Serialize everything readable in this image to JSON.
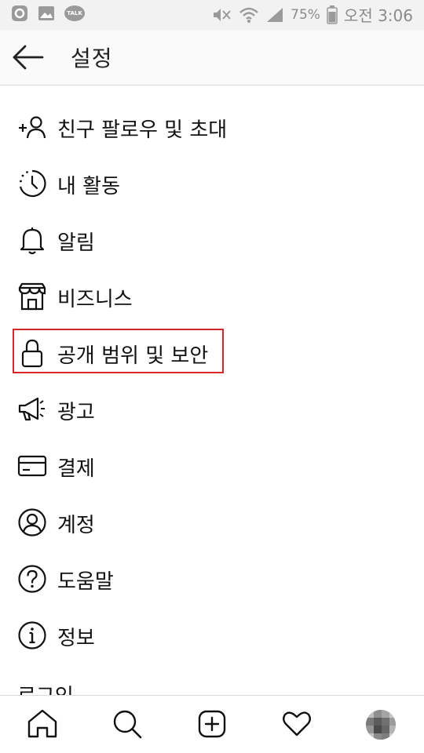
{
  "status_bar": {
    "battery": "75%",
    "time": "오전 3:06",
    "talk_badge": "TALK"
  },
  "header": {
    "title": "설정"
  },
  "menu": [
    {
      "label": "친구 팔로우 및 초대",
      "icon": "add-person-icon"
    },
    {
      "label": "내 활동",
      "icon": "activity-clock-icon"
    },
    {
      "label": "알림",
      "icon": "bell-icon"
    },
    {
      "label": "비즈니스",
      "icon": "shop-icon"
    },
    {
      "label": "공개 범위 및 보안",
      "icon": "lock-icon"
    },
    {
      "label": "광고",
      "icon": "megaphone-icon"
    },
    {
      "label": "결제",
      "icon": "credit-card-icon"
    },
    {
      "label": "계정",
      "icon": "account-circle-icon"
    },
    {
      "label": "도움말",
      "icon": "help-icon"
    },
    {
      "label": "정보",
      "icon": "info-icon"
    }
  ],
  "partial_section_label": "로그인",
  "bottom_nav": [
    "home-icon",
    "search-icon",
    "new-post-icon",
    "heart-icon",
    "profile-avatar"
  ],
  "highlight_color": "#d9262b"
}
